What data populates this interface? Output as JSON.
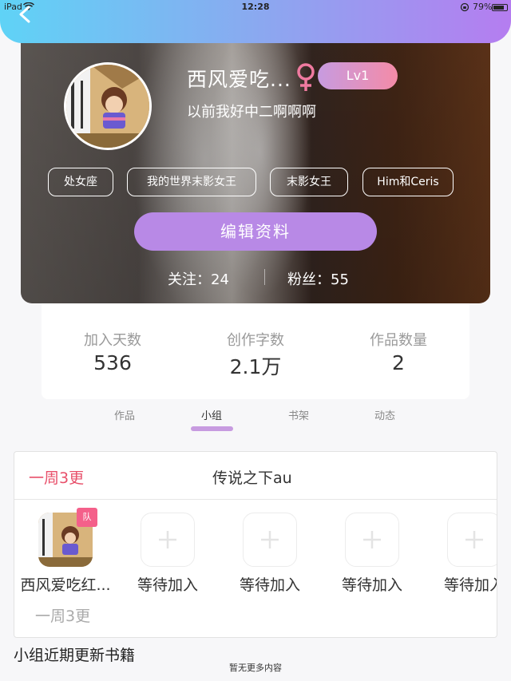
{
  "status_bar": {
    "device": "iPad",
    "time": "12:28",
    "battery": "79%"
  },
  "colors": {
    "header_gradient_start": "#5fd3f6",
    "header_gradient_end": "#b57df0",
    "accent_purple": "#b889e6",
    "accent_pink": "#e84f6a"
  },
  "profile": {
    "username": "西风爱吃...",
    "gender_icon": "female-icon",
    "level": "Lv1",
    "bio": "以前我好中二啊啊啊",
    "tags": [
      "处女座",
      "我的世界末影女王",
      "末影女王",
      "Him和Ceris"
    ],
    "edit_label": "编辑资料",
    "following": "关注：24",
    "followers": "粉丝：55"
  },
  "stats": [
    {
      "label": "加入天数",
      "value": "536"
    },
    {
      "label": "创作字数",
      "value": "2.1万"
    },
    {
      "label": "作品数量",
      "value": "2"
    }
  ],
  "tabs": [
    {
      "label": "作品"
    },
    {
      "label": "小组"
    },
    {
      "label": "书架"
    },
    {
      "label": "动态"
    }
  ],
  "active_tab": "小组",
  "group": {
    "frequency": "一周3更",
    "title": "传说之下au",
    "leader_badge": "队",
    "members": [
      {
        "name": "西风爱吃红..."
      },
      {
        "name": "等待加入"
      },
      {
        "name": "等待加入"
      },
      {
        "name": "等待加入"
      },
      {
        "name": "等待加入"
      }
    ],
    "member_frequency": "一周3更"
  },
  "recent_books_title": "小组近期更新书籍",
  "no_more_text": "暂无更多内容"
}
